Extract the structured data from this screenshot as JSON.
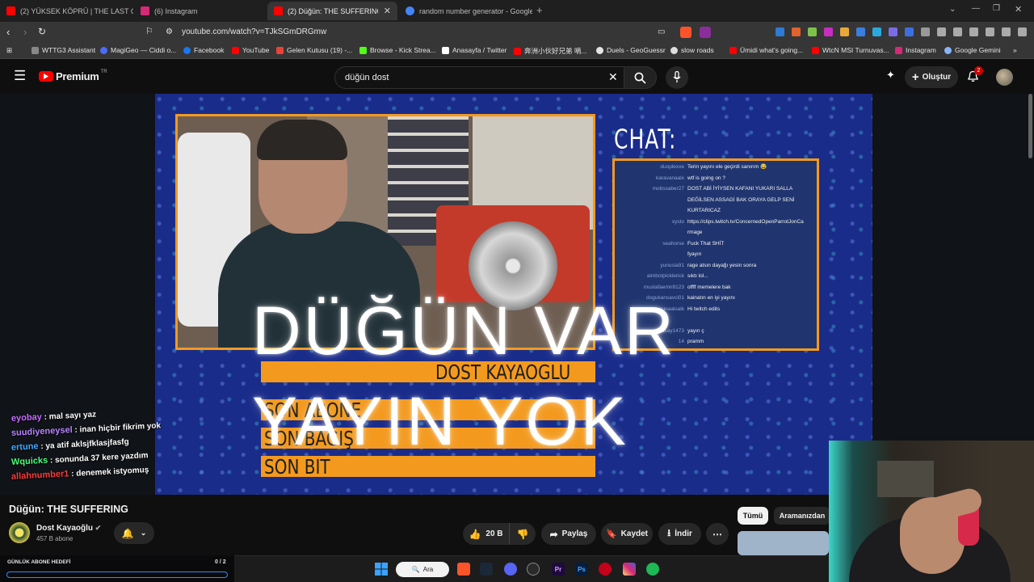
{
  "browser": {
    "tabs": [
      {
        "title": "(2) YÜKSEK KÖPRÜ | THE LAST OF US",
        "color": "#ff0000"
      },
      {
        "title": "(6) Instagram",
        "color": "#d62976"
      },
      {
        "title": "(2) Düğün: THE SUFFERING -",
        "color": "#ff0000",
        "active": true
      },
      {
        "title": "random number generator - Google",
        "color": "#4285f4"
      }
    ],
    "new_tab": "+",
    "url": "youtube.com/watch?v=TJkSGmDRGmw",
    "bookmarks": [
      {
        "label": "WTTG3 Assistant",
        "color": "#888888"
      },
      {
        "label": "MagiGeo — Ciddi o...",
        "color": "#4a6cff"
      },
      {
        "label": "Facebook",
        "color": "#1877f2"
      },
      {
        "label": "YouTube",
        "color": "#ff0000"
      },
      {
        "label": "Gelen Kutusu (19) -...",
        "color": "#ea4335"
      },
      {
        "label": "Browse - Kick Strea...",
        "color": "#53fc18"
      },
      {
        "label": "Anasayfa / Twitter",
        "color": "#ffffff"
      },
      {
        "label": "奔洲小伙好兄弟 嘀...",
        "color": "#ff0000"
      },
      {
        "label": "Duels - GeoGuessr",
        "color": "#e5e5e5"
      },
      {
        "label": "slow roads",
        "color": "#dddddd"
      },
      {
        "label": "Ümidi what's going...",
        "color": "#ff0000"
      },
      {
        "label": "WtcN MSI Turnuvas...",
        "color": "#ff0000"
      },
      {
        "label": "Instagram",
        "color": "#d62976"
      },
      {
        "label": "Google Gemini",
        "color": "#8ab4f8"
      }
    ]
  },
  "youtube": {
    "logo": "Premium",
    "logo_sup": "TR",
    "search_value": "düğün dost",
    "create_label": "Oluştur",
    "notif_count": "2"
  },
  "video": {
    "chat_title": "CHAT:",
    "chat_lines": [
      {
        "user": "duoplexxe",
        "msg": "Terin yayını ele geçirdi sanırım 😂"
      },
      {
        "user": "karavanaalx",
        "msg": "wtf is going on ?"
      },
      {
        "user": "mobssaber27",
        "msg": "DOST ABİ İYİYSEN KAFANI YUKARI SALLA"
      },
      {
        "user": "",
        "msg": "DEĞİLSEN ASSAGİ BAK ORAYA GELP SENİ"
      },
      {
        "user": "",
        "msg": "KURTARICAZ"
      },
      {
        "user": "xysto",
        "msg": "https://clips.twitch.tv/ConcernedOpenParrotJonCa"
      },
      {
        "user": "",
        "msg": "rmage"
      },
      {
        "user": "seahorse",
        "msg": "Fuck That SHİT"
      },
      {
        "user": "",
        "msg": "fyayın"
      },
      {
        "user": "yunusia91",
        "msg": "rage atsın dayağı yesin sonra"
      },
      {
        "user": "aimbotpicklerick",
        "msg": "sıktı lol..."
      },
      {
        "user": "mustafaemir8123",
        "msg": "offff memelere bak"
      },
      {
        "user": "dogukansavci01",
        "msg": "kainatın en iyi yayını"
      },
      {
        "user": "ongunaalsalk",
        "msg": "Hi twitch edits"
      },
      {
        "user": "",
        "msg": ""
      },
      {
        "user": "akay1473",
        "msg": "yayın ç"
      },
      {
        "user": "14",
        "msg": "pramm"
      }
    ],
    "streamer_name": "DOST KAYAOGLU",
    "sub_labels": [
      "SON ABONE",
      "SON BAĞIŞ",
      "SON BIT"
    ],
    "big_text_1": "DÜĞÜN VAR",
    "big_text_2": "YAYIN YOK",
    "overlay_chat": [
      {
        "user": "eyobay",
        "msg": ": mal sayı yaz",
        "color": "#c86bff"
      },
      {
        "user": "suudiyeneysel",
        "msg": ": inan hiçbir fikrim yok",
        "color": "#b884ff"
      },
      {
        "user": "ertune",
        "msg": ": ya atif aklsjfklasjfasfg",
        "color": "#3fa9ff"
      },
      {
        "user": "Wquicks",
        "msg": ": sonunda 37 kere yazdım",
        "color": "#4dff7a"
      },
      {
        "user": "allahnumber1",
        "msg": ": denemek istyomuş",
        "color": "#ff3b3b"
      }
    ]
  },
  "meta": {
    "title": "Düğün: THE SUFFERING",
    "channel": "Dost Kayaoğlu",
    "subscribers": "457 B abone",
    "likes": "20 B",
    "share": "Paylaş",
    "save": "Kaydet",
    "download": "İndir",
    "chips": [
      "Tümü",
      "Aramanızdan"
    ]
  },
  "goal": {
    "label": "GÜNLÜK ABONE HEDEFİ",
    "value": "0 / 2",
    "progress": 0
  },
  "taskbar": {
    "search_label": "Ara"
  }
}
